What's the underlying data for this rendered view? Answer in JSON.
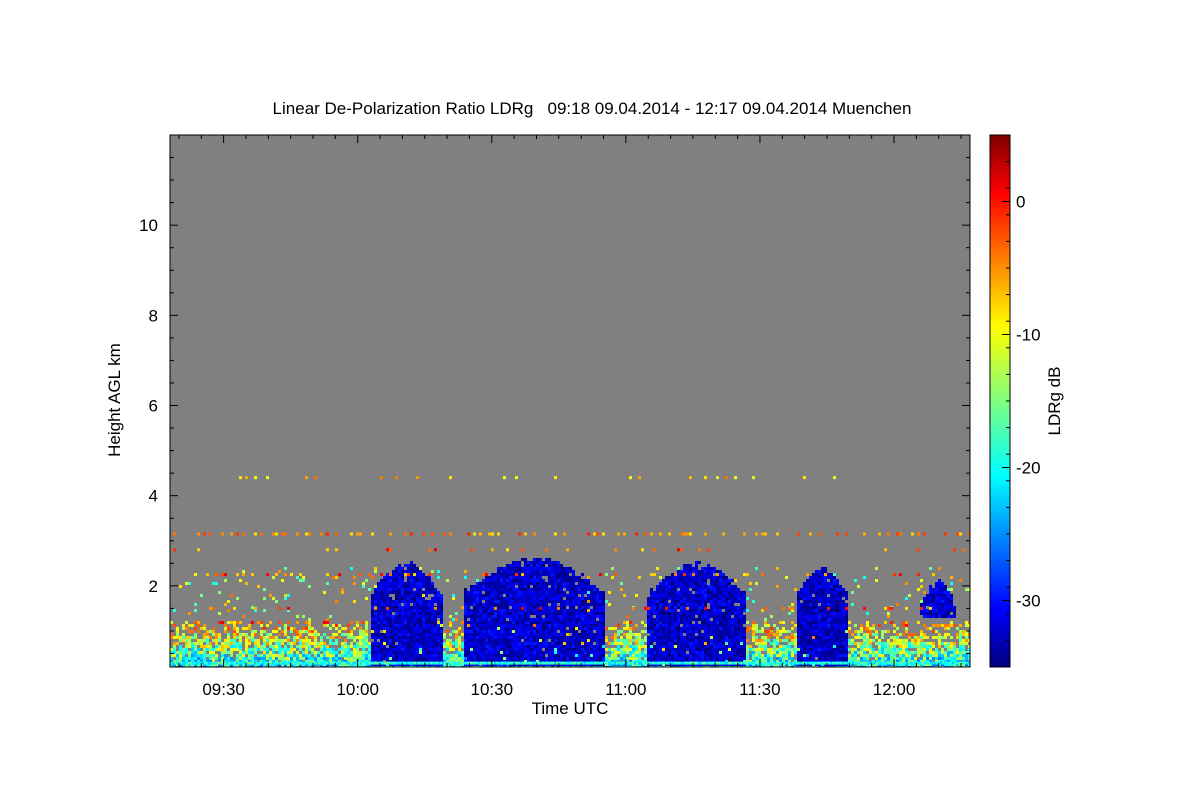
{
  "chart_data": {
    "type": "heatmap",
    "title": "Linear De-Polarization Ratio LDRg   09:18 09.04.2014 - 12:17 09.04.2014 Muenchen",
    "xlabel": "Time UTC",
    "ylabel": "Height AGL km",
    "colorbar_label": "LDRg dB",
    "x_range": [
      "09:18",
      "12:17"
    ],
    "x_ticks": [
      "09:30",
      "10:00",
      "10:30",
      "11:00",
      "11:30",
      "12:00"
    ],
    "y_range": [
      0.2,
      12.0
    ],
    "y_ticks": [
      2,
      4,
      6,
      8,
      10
    ],
    "color_range": [
      -35,
      5
    ],
    "color_ticks": [
      0,
      -10,
      -20,
      -30
    ],
    "colormap": "jet",
    "background_color": "#808080",
    "features": [
      {
        "kind": "deep-cloud",
        "time_start": "10:03",
        "time_end": "10:19",
        "top_km": 2.5,
        "ldr_db": -32
      },
      {
        "kind": "deep-cloud",
        "time_start": "10:24",
        "time_end": "10:55",
        "top_km": 2.6,
        "ldr_db": -32
      },
      {
        "kind": "deep-cloud",
        "time_start": "11:05",
        "time_end": "11:27",
        "top_km": 2.5,
        "ldr_db": -32
      },
      {
        "kind": "deep-cloud",
        "time_start": "11:38",
        "time_end": "11:50",
        "top_km": 2.4,
        "ldr_db": -32
      },
      {
        "kind": "cloud",
        "time_start": "12:06",
        "time_end": "12:14",
        "top_km": 2.1,
        "bottom_km": 1.3,
        "ldr_db": -32
      },
      {
        "kind": "aerosol-layer",
        "time_start": "09:18",
        "time_end": "12:17",
        "top_km": 1.2,
        "ldr_db": -15
      },
      {
        "kind": "noise-band",
        "height_km": 3.15,
        "ldr_db": -5
      },
      {
        "kind": "noise-band",
        "height_km": 4.4,
        "ldr_db": -8
      }
    ]
  },
  "colors": {
    "background": "#ffffff",
    "no_signal": "#808080",
    "axis": "#000000"
  }
}
